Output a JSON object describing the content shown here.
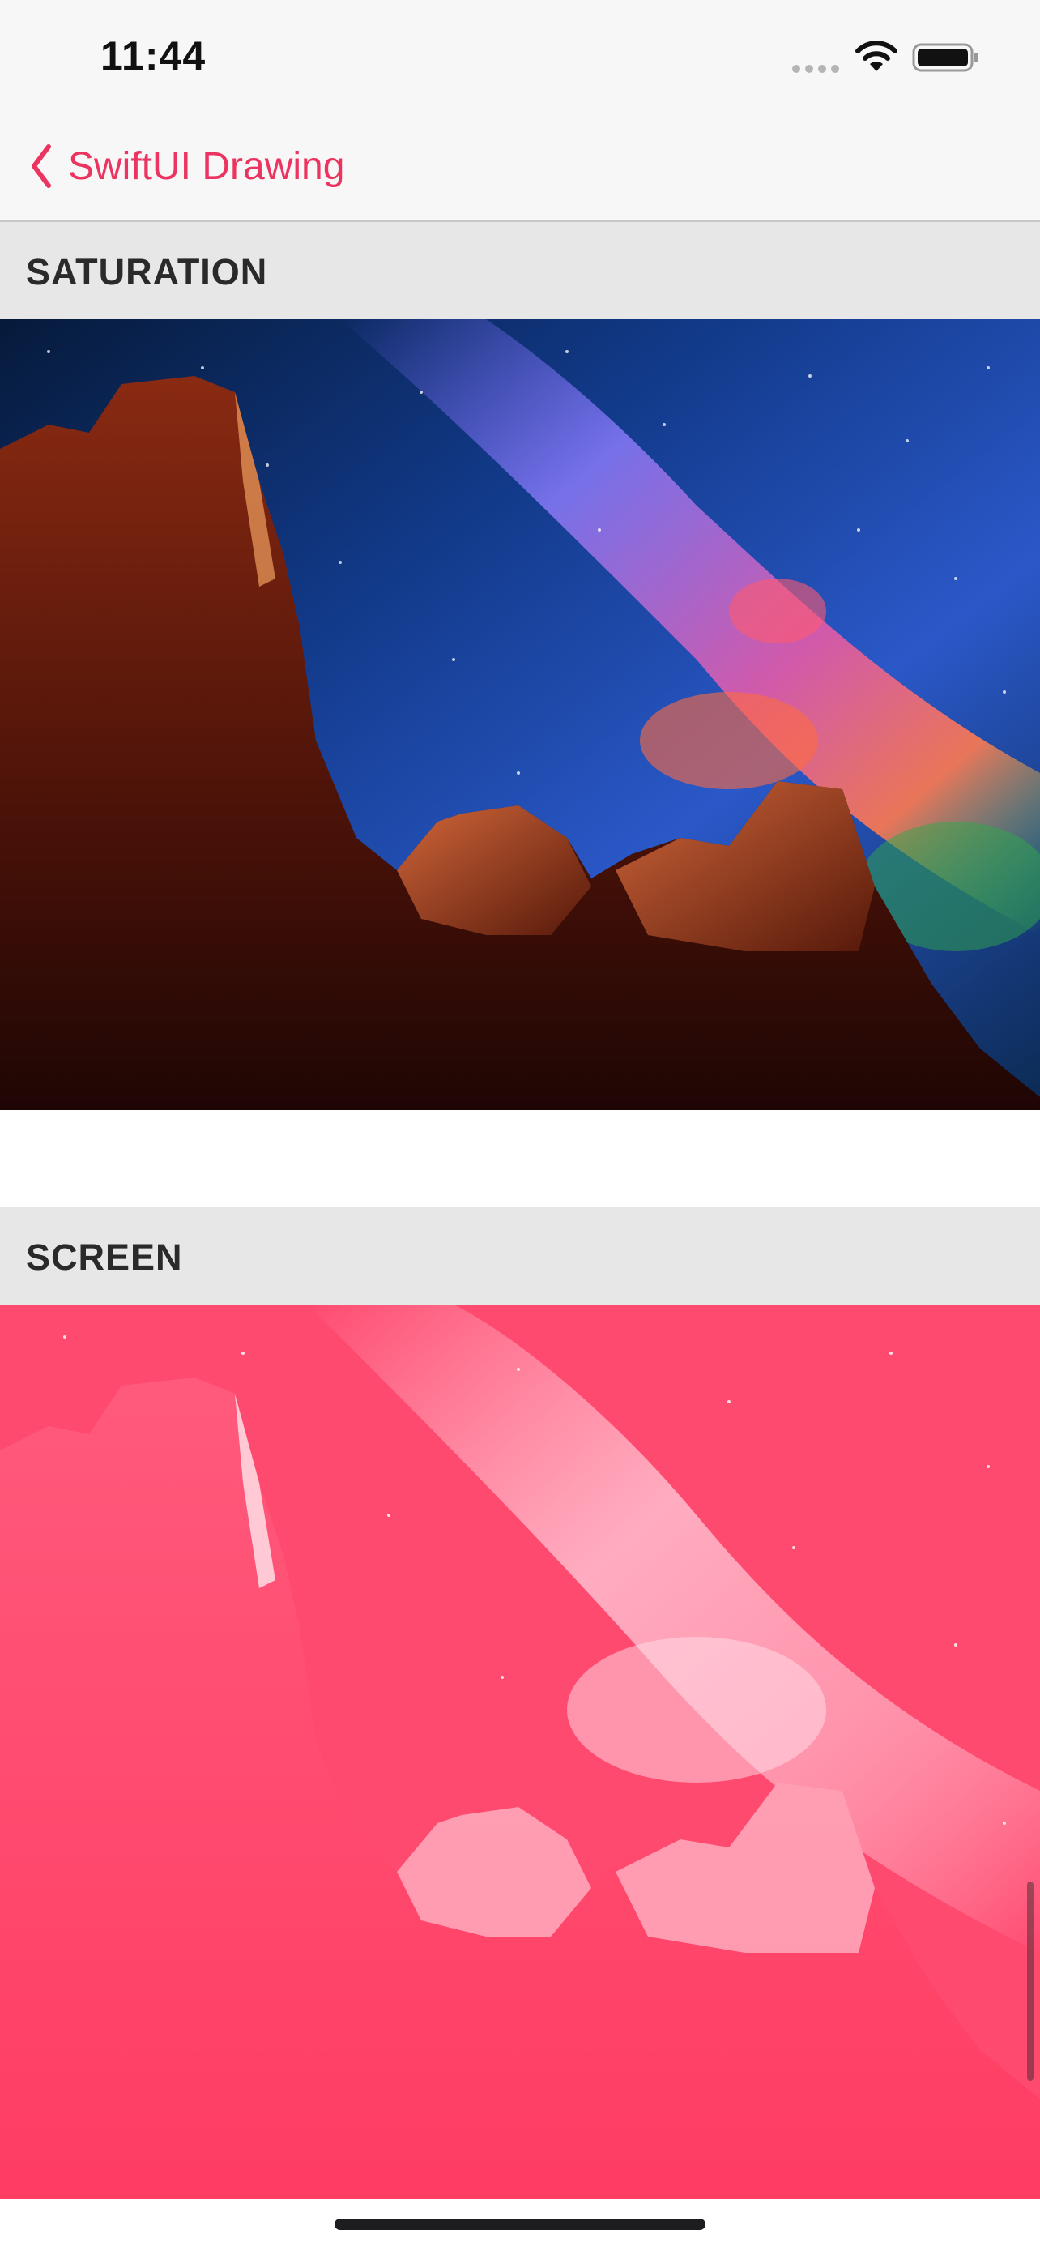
{
  "status_bar": {
    "time": "11:44"
  },
  "nav": {
    "back_label": "SwiftUI Drawing",
    "accent_color": "#ec3460"
  },
  "sections": [
    {
      "title": "SATURATION",
      "image": "night-sky-rock-formations-saturated"
    },
    {
      "title": "SCREEN",
      "image": "night-sky-rock-formations-pink-screen"
    }
  ],
  "icons": {
    "back": "chevron-left-icon",
    "wifi": "wifi-icon",
    "battery": "battery-icon",
    "signal": "cellular-signal-icon"
  }
}
